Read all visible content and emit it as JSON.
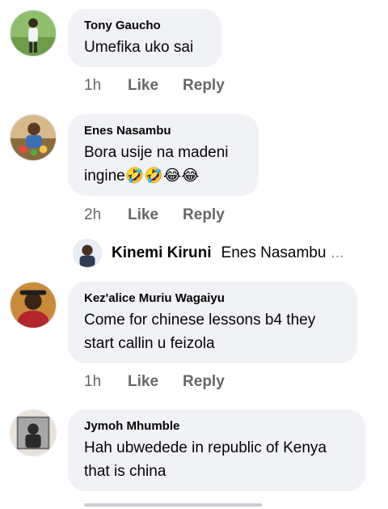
{
  "comments": [
    {
      "author": "Tony Gaucho",
      "text": "Umefika uko sai",
      "time": "1h",
      "like": "Like",
      "reply": "Reply"
    },
    {
      "author": "Enes Nasambu",
      "text_line1": "Bora usije na madeni",
      "text_line2": "ingine",
      "emojis": "🤣🤣😂😂",
      "time": "2h",
      "like": "Like",
      "reply": "Reply",
      "reply_preview": {
        "name": "Kinemi Kiruni",
        "preview": "Enes Nasambu",
        "more": "..."
      }
    },
    {
      "author": "Kez'alice Muriu Wagaiyu",
      "text_line1": "Come for chinese lessons b4 they",
      "text_line2": "start callin u feizola",
      "time": "1h",
      "like": "Like",
      "reply": "Reply"
    },
    {
      "author": "Jymoh Mhumble",
      "text_line1": "Hah ubwedede in republic of Kenya",
      "text_line2": "that is china"
    }
  ]
}
